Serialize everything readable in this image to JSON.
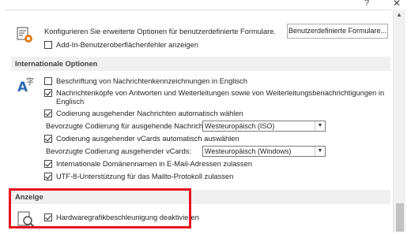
{
  "window": {
    "help_glyph": "?",
    "close_glyph": "✕"
  },
  "forms": {
    "description": "Konfigurieren Sie erweiterte Optionen für benutzerdefinierte Formulare.",
    "button_label": "Benutzerdefinierte Formulare...",
    "addin_errors_label": "Add-In-Benutzeroberflächenfehler anzeigen",
    "addin_errors_checked": false
  },
  "international": {
    "header": "Internationale Optionen",
    "english_flags_label": "Beschriftung von Nachrichtenkennzeichnungen in Englisch",
    "english_flags_checked": false,
    "english_headers_label_line1": "Nachrichtenköpfe von Antworten und Weiterleitungen sowie von Weiterleitungsbenachrichtigungen in",
    "english_headers_label_line2": "Englisch",
    "english_headers_checked": true,
    "auto_encoding_label": "Codierung ausgehender Nachrichten automatisch wählen",
    "auto_encoding_checked": true,
    "preferred_encoding_label": "Bevorzugte Codierung für ausgehende Nachrichten:",
    "preferred_encoding_value": "Westeuropäisch (ISO)",
    "vcard_auto_label": "Codierung ausgehender vCards automatisch auswählen",
    "vcard_auto_checked": true,
    "vcard_encoding_label": "Bevorzugte Codierung ausgehender vCards:",
    "vcard_encoding_value": "Westeuropäisch (Windows)",
    "idn_label": "Internationale Domänennamen in E-Mail-Adressen zulassen",
    "idn_checked": true,
    "utf8_label": "UTF-8-Unterstützung für das Mailto-Protokoll zulassen",
    "utf8_checked": true
  },
  "display": {
    "header": "Anzeige",
    "hw_accel_label": "Hardwaregrafikbeschleunigung deaktivieren",
    "hw_accel_checked": true,
    "highlight_color": "#e8121d"
  },
  "icons": {
    "forms": "form-gear-icon",
    "international": "language-icon",
    "display": "display-magnifier-icon"
  }
}
